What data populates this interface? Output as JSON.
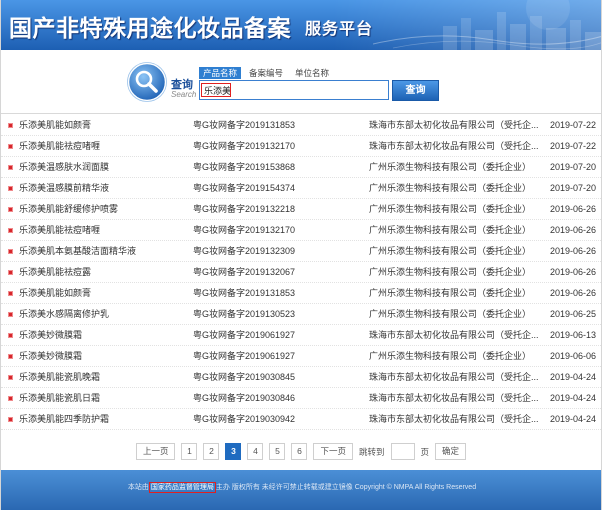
{
  "header": {
    "title": "国产非特殊用途化妆品备案",
    "subtitle": "服务平台"
  },
  "search": {
    "label": "查询",
    "label_en": "Search",
    "tabs": [
      {
        "label": "产品名称",
        "active": true
      },
      {
        "label": "备案编号",
        "active": false
      },
      {
        "label": "单位名称",
        "active": false
      }
    ],
    "value": "乐添美",
    "button": "查询"
  },
  "results": [
    {
      "name": "乐添美肌能如颜膏",
      "code": "粤G妆网备字2019131853",
      "company": "珠海市东部太初化妆品有限公司（受托企...",
      "date": "2019-07-22"
    },
    {
      "name": "乐添美肌能祛痘啫喱",
      "code": "粤G妆网备字2019132170",
      "company": "珠海市东部太初化妆品有限公司（受托企...",
      "date": "2019-07-22"
    },
    {
      "name": "乐添美温感肤水润面膜",
      "code": "粤G妆网备字2019153868",
      "company": "广州乐添生物科技有限公司（委托企业）",
      "date": "2019-07-20"
    },
    {
      "name": "乐添美温感膜前精华液",
      "code": "粤G妆网备字2019154374",
      "company": "广州乐添生物科技有限公司（委托企业）",
      "date": "2019-07-20"
    },
    {
      "name": "乐添美肌能舒缓修护喷雾",
      "code": "粤G妆网备字2019132218",
      "company": "广州乐添生物科技有限公司（委托企业）",
      "date": "2019-06-26"
    },
    {
      "name": "乐添美肌能祛痘啫喱",
      "code": "粤G妆网备字2019132170",
      "company": "广州乐添生物科技有限公司（委托企业）",
      "date": "2019-06-26"
    },
    {
      "name": "乐添美肌本氨基酸洁面精华液",
      "code": "粤G妆网备字2019132309",
      "company": "广州乐添生物科技有限公司（委托企业）",
      "date": "2019-06-26"
    },
    {
      "name": "乐添美肌能祛痘露",
      "code": "粤G妆网备字2019132067",
      "company": "广州乐添生物科技有限公司（委托企业）",
      "date": "2019-06-26"
    },
    {
      "name": "乐添美肌能如颜膏",
      "code": "粤G妆网备字2019131853",
      "company": "广州乐添生物科技有限公司（委托企业）",
      "date": "2019-06-26"
    },
    {
      "name": "乐添美水感隔离修护乳",
      "code": "粤G妆网备字2019130523",
      "company": "广州乐添生物科技有限公司（委托企业）",
      "date": "2019-06-25"
    },
    {
      "name": "乐添美妙微膜霜",
      "code": "粤G妆网备字2019061927",
      "company": "珠海市东部太初化妆品有限公司（受托企...",
      "date": "2019-06-13"
    },
    {
      "name": "乐添美妙微膜霜",
      "code": "粤G妆网备字2019061927",
      "company": "广州乐添生物科技有限公司（委托企业）",
      "date": "2019-06-06"
    },
    {
      "name": "乐添美肌能瓷肌晚霜",
      "code": "粤G妆网备字2019030845",
      "company": "珠海市东部太初化妆品有限公司（受托企...",
      "date": "2019-04-24"
    },
    {
      "name": "乐添美肌能瓷肌日霜",
      "code": "粤G妆网备字2019030846",
      "company": "珠海市东部太初化妆品有限公司（受托企...",
      "date": "2019-04-24"
    },
    {
      "name": "乐添美肌能四季防护霜",
      "code": "粤G妆网备字2019030942",
      "company": "珠海市东部太初化妆品有限公司（受托企...",
      "date": "2019-04-24"
    }
  ],
  "pagination": {
    "prev": "上一页",
    "pages": [
      "1",
      "2",
      "3",
      "4",
      "5",
      "6"
    ],
    "current": "3",
    "next": "下一页",
    "jump_label": "跳转到",
    "page_unit": "页",
    "confirm": "确定"
  },
  "footer": {
    "prefix": "本站由",
    "org": "国家药品监督管理局",
    "suffix": "主办 版权所有 未经许可禁止转载或建立镜像 Copyright © NMPA All Rights Reserved"
  },
  "icons": {
    "search": "magnifier-icon",
    "bullet": "red-square-bullet-icon"
  },
  "colors": {
    "header-top": "#4a96e6",
    "header-bottom": "#1d5fb3",
    "accent": "#2f7fd1",
    "bullet": "#d6262b",
    "highlight": "#e02020",
    "footer-top": "#4b8fd6",
    "footer-bottom": "#2a68b2",
    "text": "#333333"
  }
}
